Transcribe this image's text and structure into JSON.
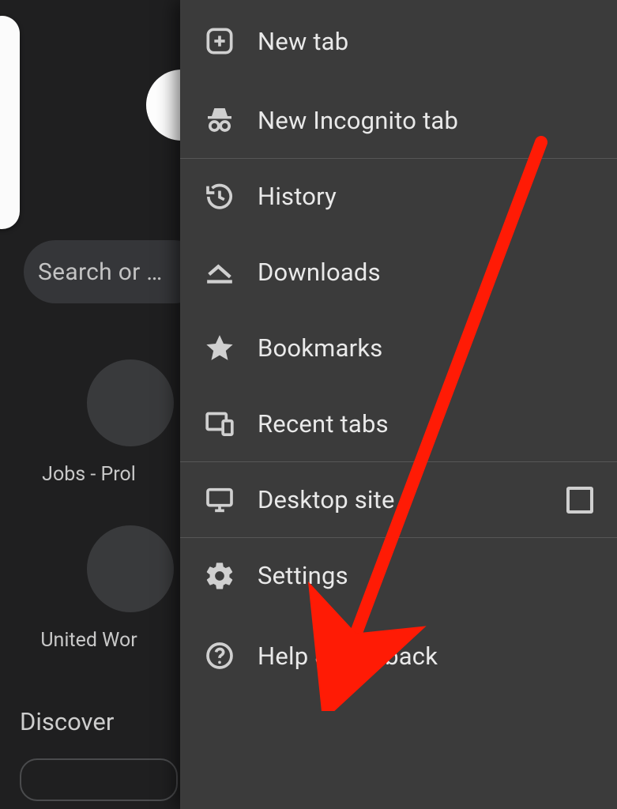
{
  "background": {
    "search_placeholder": "Search or …",
    "shortcuts": [
      {
        "label": "Jobs - Prol"
      },
      {
        "label": "United Wor"
      }
    ],
    "discover_label": "Discover"
  },
  "menu": {
    "new_tab": "New tab",
    "incognito": "New Incognito tab",
    "history": "History",
    "downloads": "Downloads",
    "bookmarks": "Bookmarks",
    "recent_tabs": "Recent tabs",
    "desktop_site": "Desktop site",
    "settings": "Settings",
    "help_feedback": "Help & feedback"
  },
  "annotation": {
    "arrow_color": "#ff1b05",
    "arrow_target": "settings"
  }
}
